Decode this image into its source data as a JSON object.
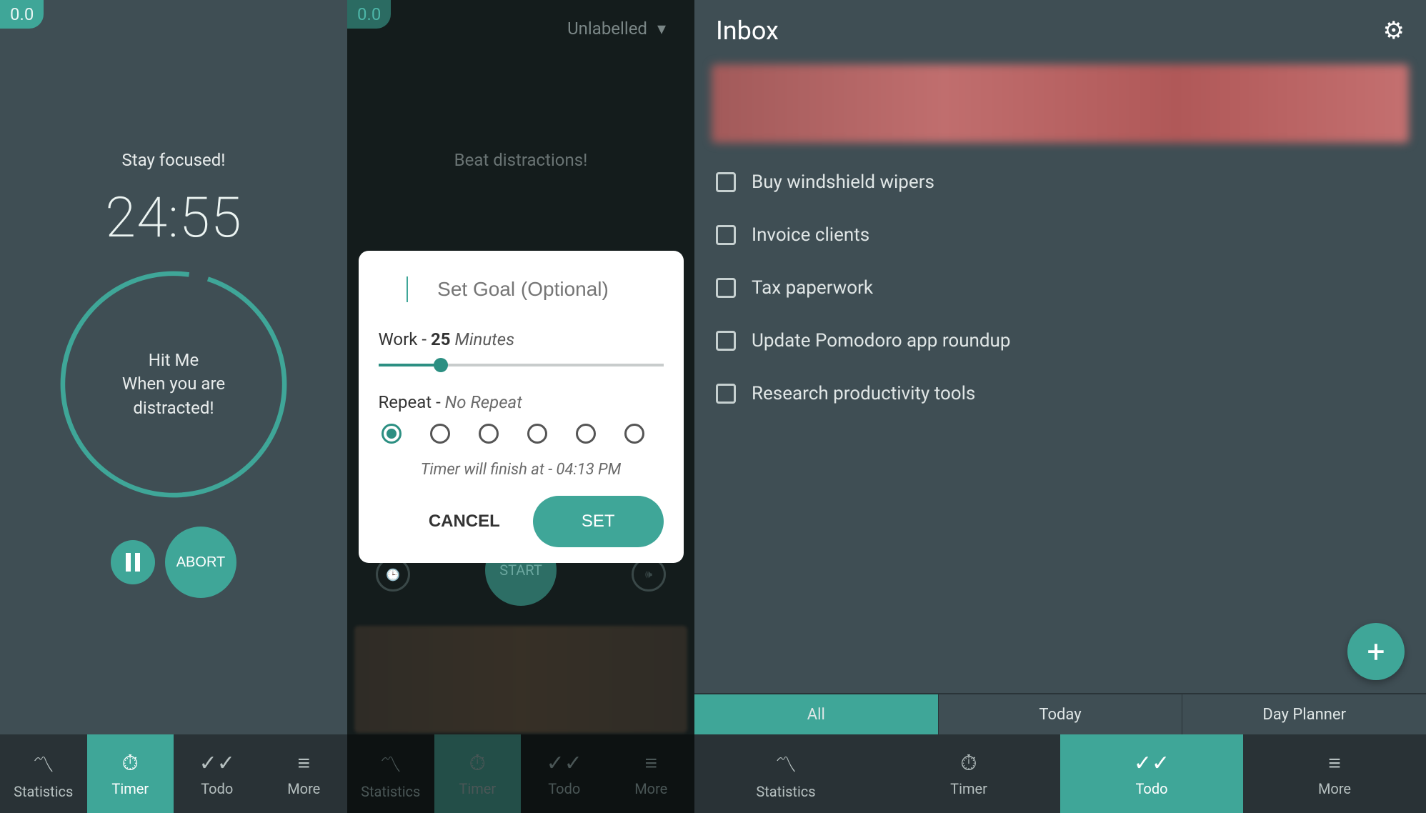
{
  "panel1": {
    "version": "0.0",
    "focus": "Stay focused!",
    "timer": "24:55",
    "circle_line1": "Hit Me",
    "circle_line2": "When you are distracted!",
    "abort": "ABORT"
  },
  "panel2": {
    "version": "0.0",
    "label_dropdown": "Unlabelled",
    "focus": "Beat distractions!",
    "start": "START",
    "dialog": {
      "goal_placeholder": "Set Goal (Optional)",
      "work_prefix": "Work - ",
      "work_value": "25",
      "work_unit": "Minutes",
      "repeat_prefix": "Repeat - ",
      "repeat_value": "No Repeat",
      "finish": "Timer will finish at - 04:13 PM",
      "cancel": "CANCEL",
      "set": "SET"
    }
  },
  "panel3": {
    "title": "Inbox",
    "todos": [
      "Buy windshield wipers",
      "Invoice clients",
      "Tax paperwork",
      "Update Pomodoro app roundup",
      "Research productivity tools"
    ],
    "filters": {
      "all": "All",
      "today": "Today",
      "planner": "Day Planner"
    }
  },
  "nav": {
    "statistics": "Statistics",
    "timer": "Timer",
    "todo": "Todo",
    "more": "More"
  }
}
